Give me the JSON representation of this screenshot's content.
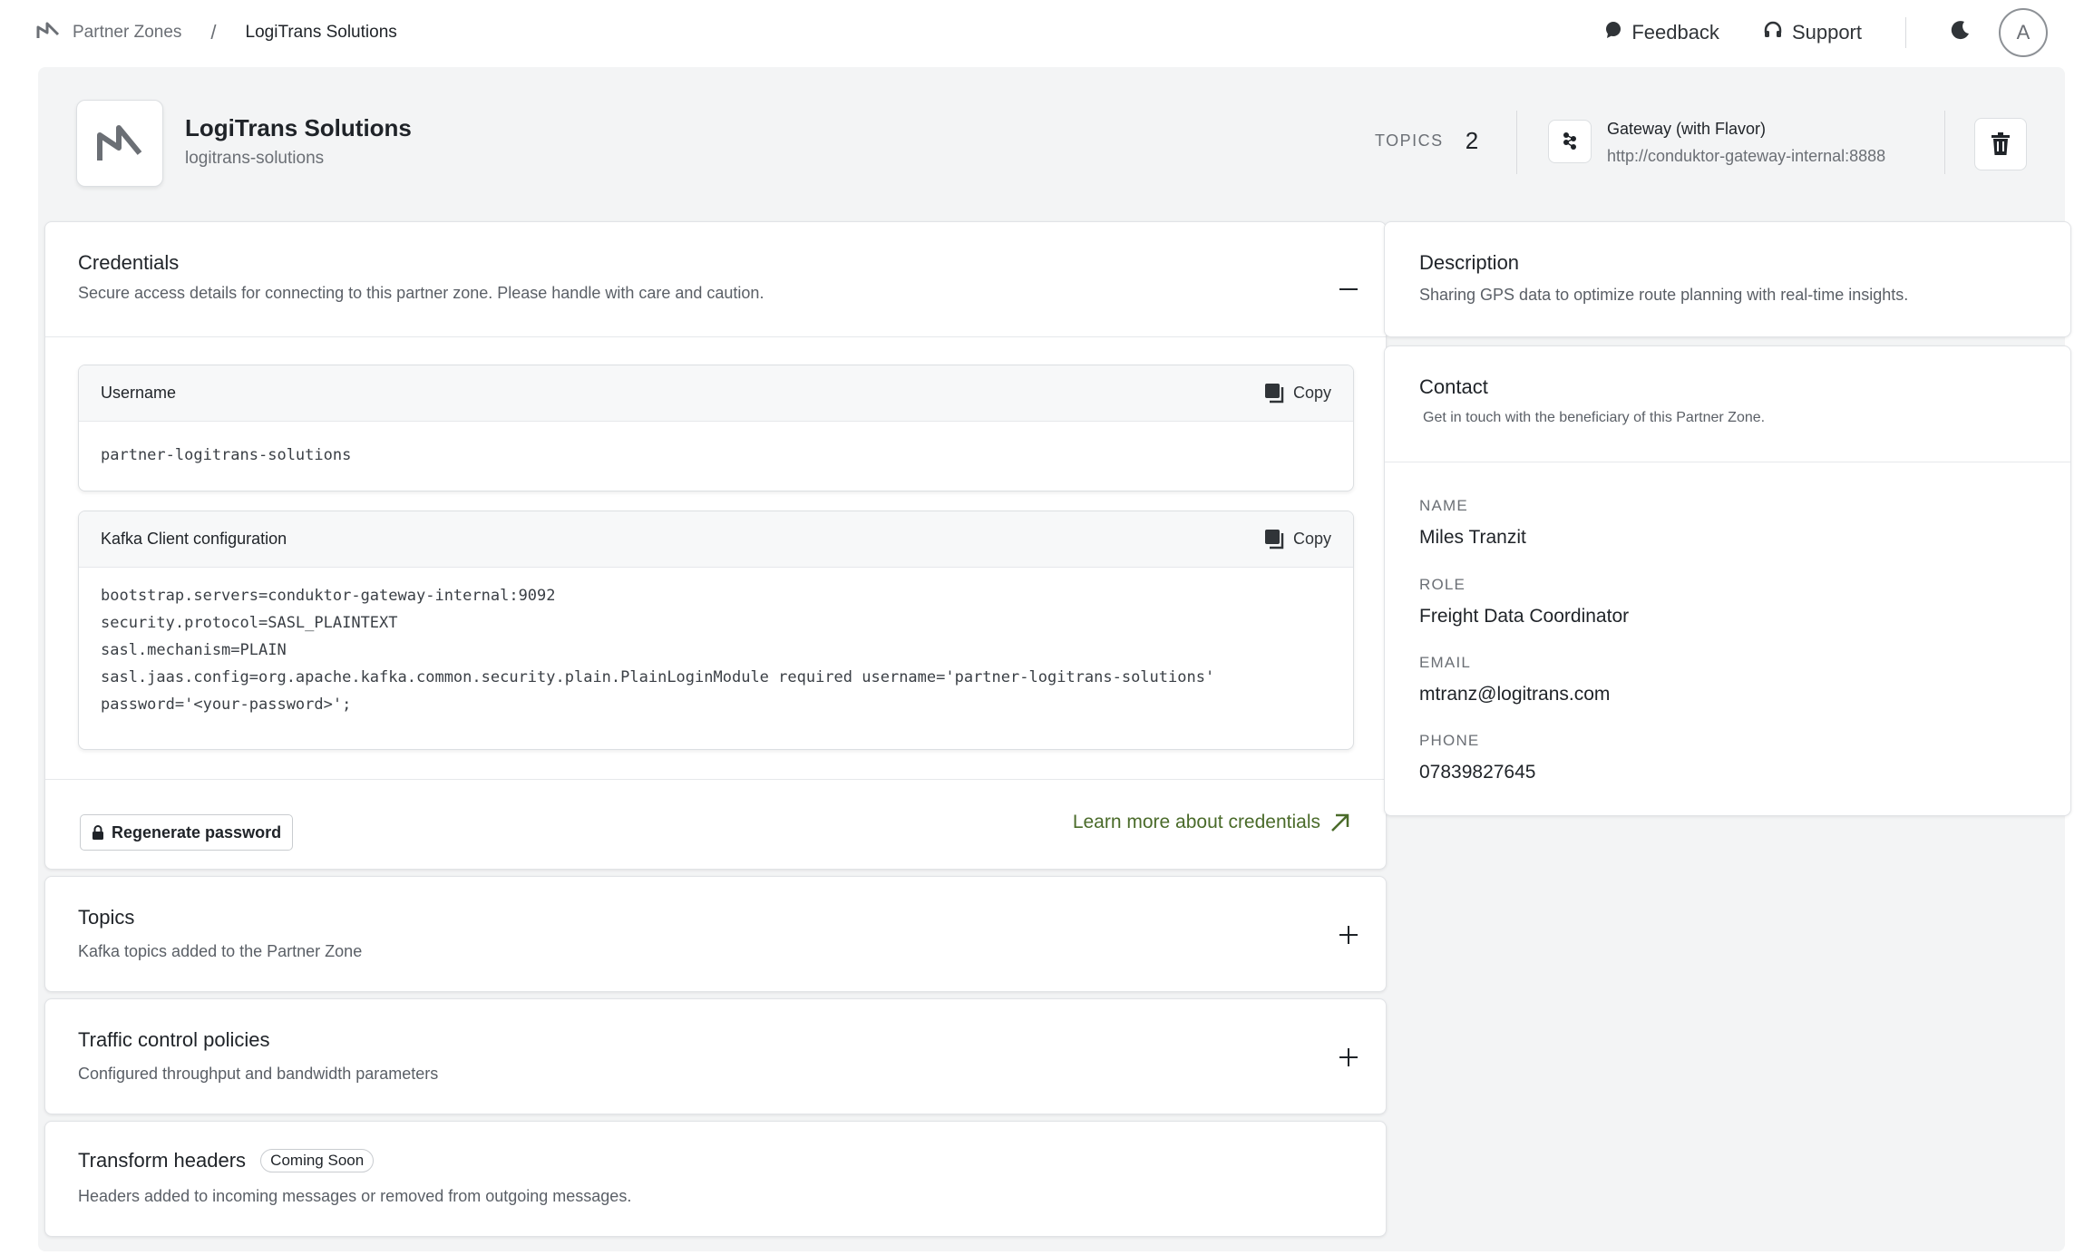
{
  "breadcrumb": {
    "parent": "Partner Zones",
    "separator": "/",
    "current": "LogiTrans Solutions"
  },
  "topbar": {
    "feedback_label": "Feedback",
    "support_label": "Support",
    "avatar_initial": "A"
  },
  "zone": {
    "name": "LogiTrans Solutions",
    "slug": "logitrans-solutions",
    "topics_label": "TOPICS",
    "topics_count": "2",
    "gateway_title": "Gateway (with Flavor)",
    "gateway_url": "http://conduktor-gateway-internal:8888"
  },
  "credentials": {
    "title": "Credentials",
    "subtitle": "Secure access details for connecting to this partner zone. Please handle with care and caution.",
    "username_label": "Username",
    "username_value": "partner-logitrans-solutions",
    "kafka_label": "Kafka Client configuration",
    "kafka_config": "bootstrap.servers=conduktor-gateway-internal:9092\nsecurity.protocol=SASL_PLAINTEXT\nsasl.mechanism=PLAIN\nsasl.jaas.config=org.apache.kafka.common.security.plain.PlainLoginModule required username='partner-logitrans-solutions'\npassword='<your-password>';",
    "copy_label": "Copy",
    "regenerate_label": "Regenerate password",
    "learn_more_label": "Learn more about credentials"
  },
  "topics": {
    "title": "Topics",
    "subtitle": "Kafka topics added to the Partner Zone"
  },
  "traffic": {
    "title": "Traffic control policies",
    "subtitle": "Configured throughput and bandwidth parameters"
  },
  "transform": {
    "title": "Transform headers",
    "badge": "Coming Soon",
    "subtitle": "Headers added to incoming messages or removed from outgoing messages."
  },
  "description": {
    "title": "Description",
    "text": "Sharing GPS data to optimize route planning with real-time insights."
  },
  "contact": {
    "title": "Contact",
    "subtitle": "Get in touch with the beneficiary of this Partner Zone.",
    "name_label": "NAME",
    "name_value": "Miles Tranzit",
    "role_label": "ROLE",
    "role_value": "Freight Data Coordinator",
    "email_label": "EMAIL",
    "email_value": "mtranz@logitrans.com",
    "phone_label": "PHONE",
    "phone_value": "07839827645"
  },
  "colors": {
    "accent_link": "#4a6b2a",
    "page_bg": "#f3f4f5"
  }
}
